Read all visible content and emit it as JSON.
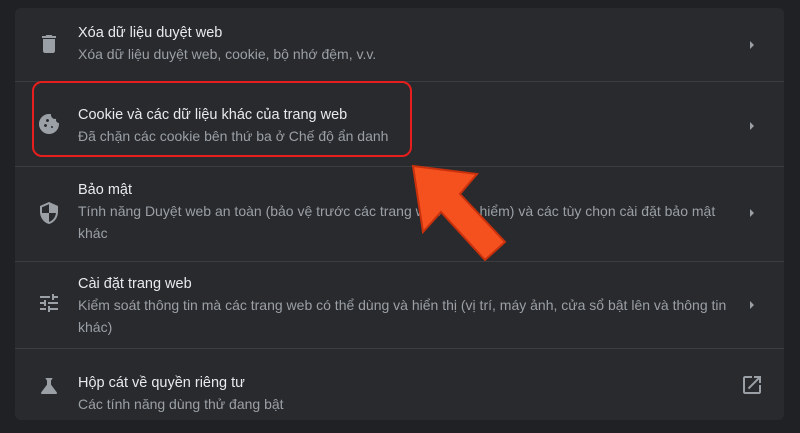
{
  "rows": [
    {
      "title": "Xóa dữ liệu duyệt web",
      "subtitle": "Xóa dữ liệu duyệt web, cookie, bộ nhớ đệm, v.v.",
      "icon": "trash-icon"
    },
    {
      "title": "Cookie và các dữ liệu khác của trang web",
      "subtitle": "Đã chặn các cookie bên thứ ba ở Chế độ ẩn danh",
      "icon": "cookie-icon"
    },
    {
      "title": "Bảo mật",
      "subtitle": "Tính năng Duyệt web an toàn (bảo vệ trước các trang web nguy hiểm) và các tùy chọn cài đặt bảo mật khác",
      "icon": "shield-icon"
    },
    {
      "title": "Cài đặt trang web",
      "subtitle": "Kiểm soát thông tin mà các trang web có thể dùng và hiển thị (vị trí, máy ảnh, cửa sổ bật lên và thông tin khác)",
      "icon": "tune-icon"
    },
    {
      "title": "Hộp cát về quyền riêng tư",
      "subtitle": "Các tính năng dùng thử đang bật",
      "icon": "flask-icon"
    }
  ],
  "colors": {
    "background": "#202124",
    "card": "#292a2d",
    "title_text": "#e8eaed",
    "subtitle_text": "#9aa0a6",
    "icon": "#9aa0a6",
    "highlight_border": "#e61e1e",
    "arrow": "#f4511e"
  }
}
